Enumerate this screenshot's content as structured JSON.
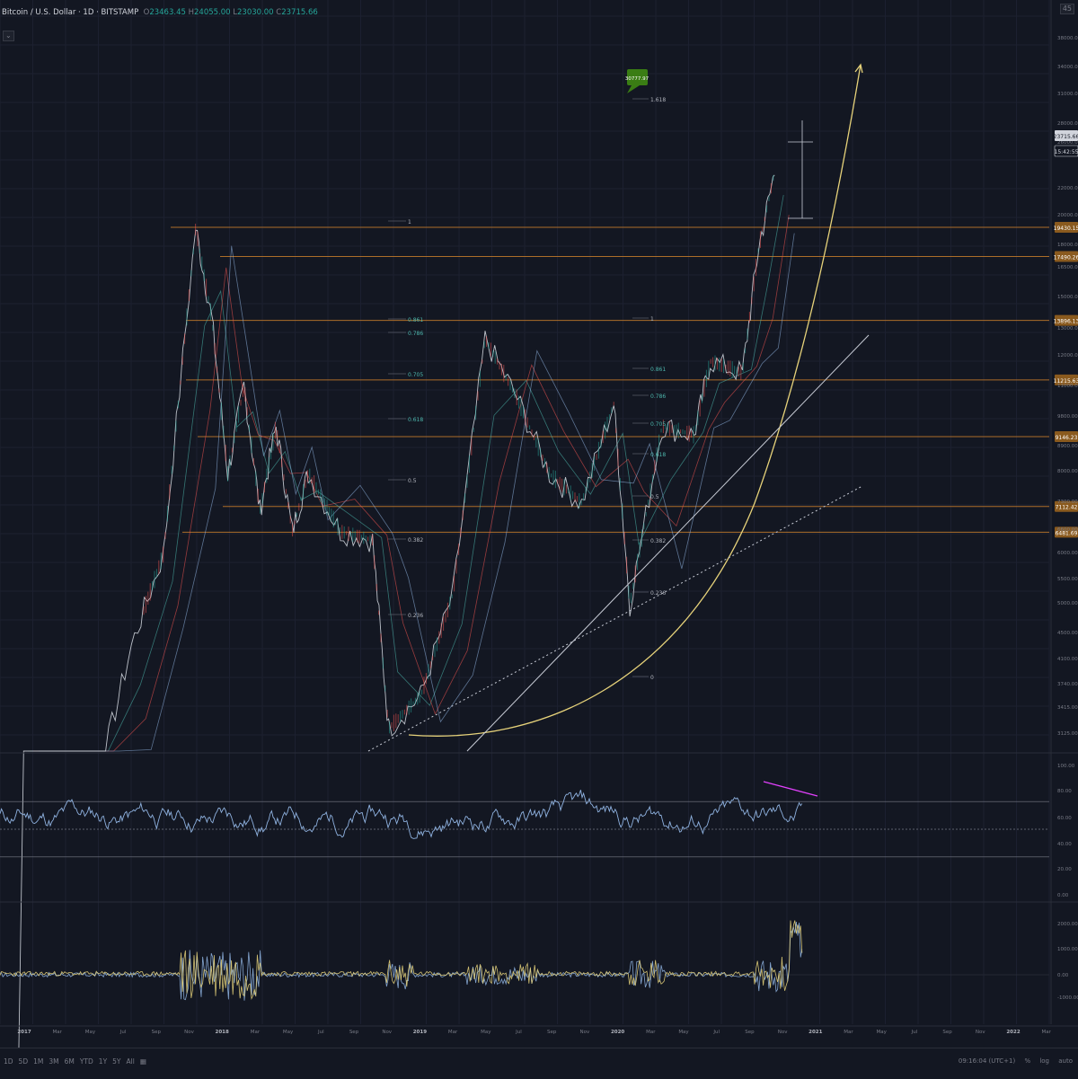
{
  "header": {
    "symbol": "Bitcoin / U.S. Dollar · 1D · BITSTAMP",
    "o_label": "O",
    "o_value": "23463.45",
    "h_label": "H",
    "h_value": "24055.00",
    "l_label": "L",
    "l_value": "23030.00",
    "c_label": "C",
    "c_value": "23715.66",
    "collapse_label": "⌄",
    "top_right_icon": "settings-icon",
    "top_right_number": "45"
  },
  "colors": {
    "background": "#131722",
    "grid": "#1c2030",
    "fib_line": "#c77c2b",
    "fib_label": "#4db6ac",
    "curve": "#e6d27a",
    "rsi": "#8fb2e0",
    "osc_a": "#8fb2e0",
    "osc_b": "#e6d27a",
    "divergence": "#e040fb",
    "price_tag_bg": "#3a7d14"
  },
  "chart_data": [
    {
      "type": "line",
      "title": "",
      "scale": "log",
      "price_axis_ticks": [
        "38000.00",
        "34000.00",
        "31000.00",
        "28000.00",
        "26000.00",
        "22000.00",
        "20000.00",
        "18000.00",
        "16500.00",
        "15000.00",
        "13000.00",
        "12000.00",
        "11000.00",
        "9800.00",
        "8900.00",
        "8000.00",
        "7300.00",
        "6600.00",
        "6000.00",
        "5500.00",
        "5000.00",
        "4500.00",
        "4100.00",
        "3740.00",
        "3415.00",
        "3125.00"
      ],
      "time_axis_ticks": [
        "2017",
        "Mar",
        "May",
        "Jul",
        "Sep",
        "Nov",
        "2018",
        "Mar",
        "May",
        "Jul",
        "Sep",
        "Nov",
        "2019",
        "Mar",
        "May",
        "Jul",
        "Sep",
        "Nov",
        "2020",
        "Mar",
        "May",
        "Jul",
        "Sep",
        "Nov",
        "2021",
        "Mar",
        "May",
        "Jul",
        "Sep",
        "Nov",
        "2022",
        "Mar"
      ],
      "current_price": "23715.66",
      "countdown": "15:42:55",
      "horizontal_levels": [
        {
          "price": 19430.15,
          "label": "19430.15"
        },
        {
          "price": 17490.26,
          "label": "17490.26"
        },
        {
          "price": 13896.13,
          "label": "13896.13"
        },
        {
          "price": 11215.63,
          "label": "11215.63"
        },
        {
          "price": 9146.23,
          "label": "9146.23"
        },
        {
          "price": 7112.42,
          "label": "7112.42"
        },
        {
          "price": 6481.69,
          "label": "6481.69"
        }
      ],
      "fib_set_1": [
        "1",
        "0.861",
        "0.786",
        "0.705",
        "0.618",
        "0.5",
        "0.382",
        "0.236"
      ],
      "fib_set_2": [
        "1.618",
        "1",
        "0.861",
        "0.786",
        "0.705",
        "0.618",
        "0.5",
        "0.382",
        "0.236",
        "0"
      ],
      "target_price_label": "30777.97",
      "approx_price_series": [
        {
          "date": "2017-01",
          "price": 1000
        },
        {
          "date": "2017-04",
          "price": 1200
        },
        {
          "date": "2017-06",
          "price": 2700
        },
        {
          "date": "2017-08",
          "price": 4300
        },
        {
          "date": "2017-10",
          "price": 6000
        },
        {
          "date": "2017-12",
          "price": 19400
        },
        {
          "date": "2018-01",
          "price": 14000
        },
        {
          "date": "2018-02",
          "price": 8000
        },
        {
          "date": "2018-03",
          "price": 11000
        },
        {
          "date": "2018-04",
          "price": 7000
        },
        {
          "date": "2018-05",
          "price": 9500
        },
        {
          "date": "2018-06",
          "price": 6500
        },
        {
          "date": "2018-07",
          "price": 8000
        },
        {
          "date": "2018-09",
          "price": 6500
        },
        {
          "date": "2018-11",
          "price": 6300
        },
        {
          "date": "2018-12",
          "price": 3200
        },
        {
          "date": "2019-02",
          "price": 3600
        },
        {
          "date": "2019-04",
          "price": 5200
        },
        {
          "date": "2019-06",
          "price": 13000
        },
        {
          "date": "2019-08",
          "price": 10500
        },
        {
          "date": "2019-10",
          "price": 8000
        },
        {
          "date": "2019-12",
          "price": 7200
        },
        {
          "date": "2020-02",
          "price": 10300
        },
        {
          "date": "2020-03",
          "price": 5000
        },
        {
          "date": "2020-05",
          "price": 9500
        },
        {
          "date": "2020-07",
          "price": 9200
        },
        {
          "date": "2020-08",
          "price": 12000
        },
        {
          "date": "2020-10",
          "price": 11500
        },
        {
          "date": "2020-11",
          "price": 18000
        },
        {
          "date": "2020-12",
          "price": 23700
        }
      ]
    },
    {
      "type": "line",
      "title": "",
      "axis_ticks": [
        "100.00",
        "80.00",
        "60.00",
        "40.00",
        "20.00",
        "0.00"
      ],
      "upper_band": 70,
      "lower_band": 30,
      "middle_line": 50
    },
    {
      "type": "line",
      "title": "",
      "axis_ticks": [
        "2000.00",
        "1000.00",
        "0.00",
        "-1000.00"
      ]
    }
  ],
  "footer": {
    "ranges": [
      "1D",
      "5D",
      "1M",
      "3M",
      "6M",
      "YTD",
      "1Y",
      "5Y",
      "All"
    ],
    "goto_icon": "calendar-icon",
    "time": "09:16:04 (UTC+1)",
    "pct": "%",
    "log": "log",
    "auto": "auto"
  }
}
